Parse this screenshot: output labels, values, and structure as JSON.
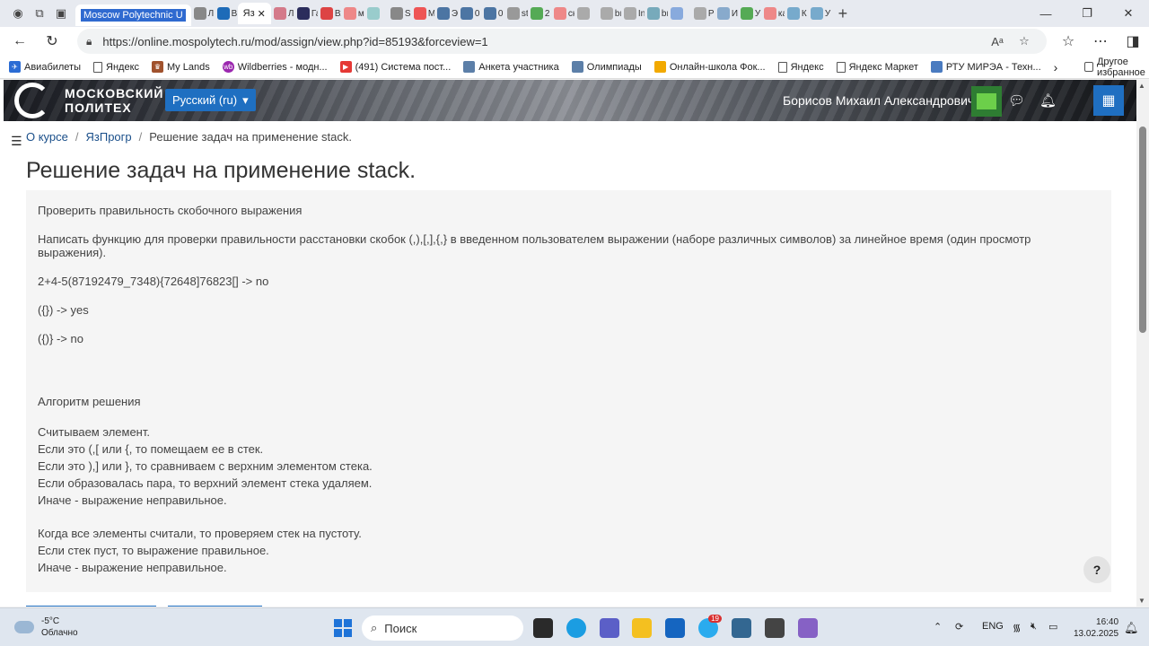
{
  "browser": {
    "active_tab_title": "Moscow Polytechnic U",
    "current_tab_label": "Яз",
    "mini_tabs": [
      "Л",
      "В",
      "Л",
      "Га",
      "",
      "Вх",
      "м",
      "",
      "Sı",
      "М",
      "Э",
      "0",
      "0",
      "st",
      "2",
      "ск",
      "",
      "bı",
      "In",
      "bı",
      "",
      "Р",
      "И",
      "У",
      "ка",
      "К",
      "У"
    ],
    "url": "https://online.mospolytech.ru/mod/assign/view.php?id=85193&forceview=1"
  },
  "bookmarks": [
    {
      "label": "Авиабилеты",
      "icon": "plane-icon",
      "color": "#2b6cd4"
    },
    {
      "label": "Яндекс",
      "icon": "doc-icon",
      "color": ""
    },
    {
      "label": "My Lands",
      "icon": "game-icon",
      "color": "#a0522d"
    },
    {
      "label": "Wildberries - модн...",
      "icon": "wb-icon",
      "color": "#9b27af"
    },
    {
      "label": "(491) Система пост...",
      "icon": "youtube-icon",
      "color": "#e53935"
    },
    {
      "label": "Анкета участника",
      "icon": "form-icon",
      "color": "#5c7fa8"
    },
    {
      "label": "Олимпиады",
      "icon": "olymp-icon",
      "color": "#5c7fa8"
    },
    {
      "label": "Онлайн-школа Фок...",
      "icon": "school-icon",
      "color": "#f2a900"
    },
    {
      "label": "Яндекс",
      "icon": "doc-icon",
      "color": ""
    },
    {
      "label": "Яндекс Маркет",
      "icon": "doc-icon",
      "color": ""
    },
    {
      "label": "РТУ МИРЭА - Техн...",
      "icon": "mirea-icon",
      "color": "#4a7bc0"
    }
  ],
  "bookmarks_other": "Другое избранное",
  "moodle": {
    "logo_line1": "МОСКОВСКИЙ",
    "logo_line2": "ПОЛИТЕХ",
    "language": "Русский (ru)",
    "user_name": "Борисов Михаил Александрович",
    "breadcrumb": [
      "О курсе",
      "ЯзПрогр",
      "Решение задач на применение stack."
    ],
    "page_title": "Решение задач на применение stack.",
    "intro": {
      "p1": "Проверить правильность скобочного выражения",
      "p2": "Написать функцию для проверки правильности расстановки скобок (,),[,],{,} в введенном пользователем выражении  (наборе различных символов) за линейное время (один просмотр выражения).",
      "p3": "2+4-5(87192479_7348){72648]76823[] -> no",
      "p4": "({}) -> yes",
      "p5": "({)} -> no",
      "p6": "Алгоритм решения",
      "algo": [
        "Считываем элемент.",
        "Если это (,[ или {, то помещаем ее в стек.",
        "Если это ),] или }, то сравниваем с верхним элементом стека.",
        "Если образовалась пара, то верхний элемент стека удаляем.",
        "Иначе - выражение неправильное."
      ],
      "final": [
        "Когда все элементы считали, то проверяем стек на пустоту.",
        "Если стек пуст, то выражение правильное.",
        "Иначе - выражение неправильное."
      ]
    },
    "help": "?"
  },
  "taskbar": {
    "temperature": "-5°C",
    "weather": "Облачно",
    "search_placeholder": "Поиск",
    "lang": "ENG",
    "time": "16:40",
    "date": "13.02.2025",
    "telegram_badge": "19"
  }
}
